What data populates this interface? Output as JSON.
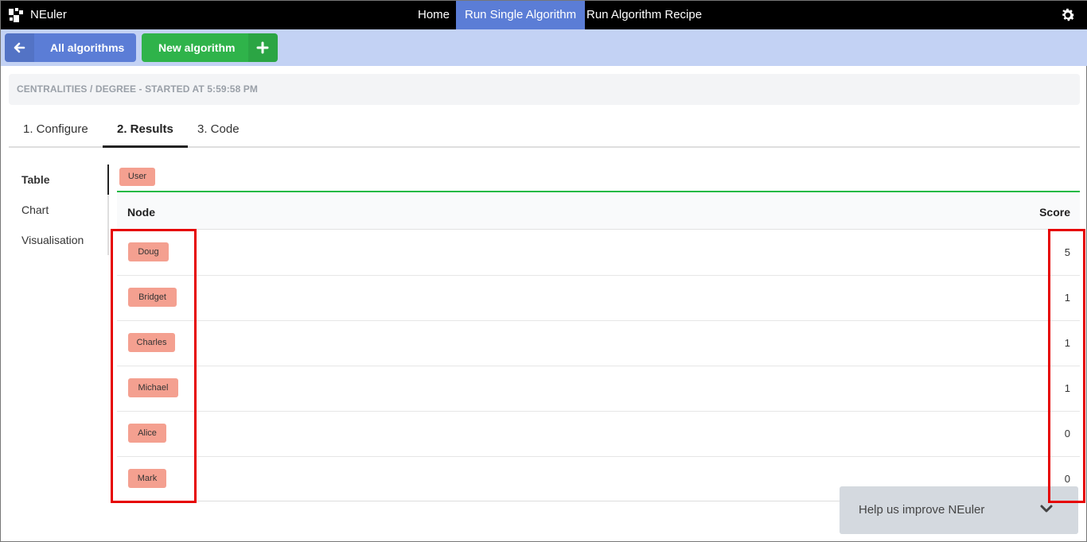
{
  "app": {
    "name": "NEuler"
  },
  "nav": {
    "items": [
      {
        "label": "Home",
        "active": false
      },
      {
        "label": "Run Single Algorithm",
        "active": true
      },
      {
        "label": "Run Algorithm Recipe",
        "active": false
      }
    ]
  },
  "toolbar": {
    "all_algorithms_label": "All algorithms",
    "new_algorithm_label": "New algorithm"
  },
  "breadcrumb": {
    "text": "CENTRALITIES / DEGREE - STARTED AT 5:59:58 PM"
  },
  "tabs": [
    {
      "label": "1. Configure",
      "active": false
    },
    {
      "label": "2. Results",
      "active": true
    },
    {
      "label": "3. Code",
      "active": false
    }
  ],
  "side_menu": [
    {
      "label": "Table",
      "active": true
    },
    {
      "label": "Chart",
      "active": false
    },
    {
      "label": "Visualisation",
      "active": false
    }
  ],
  "label_filter": "User",
  "table": {
    "headers": {
      "node": "Node",
      "score": "Score"
    },
    "rows": [
      {
        "node": "Doug",
        "score": "5"
      },
      {
        "node": "Bridget",
        "score": "1"
      },
      {
        "node": "Charles",
        "score": "1"
      },
      {
        "node": "Michael",
        "score": "1"
      },
      {
        "node": "Alice",
        "score": "0"
      },
      {
        "node": "Mark",
        "score": "0"
      }
    ]
  },
  "feedback": {
    "text": "Help us improve NEuler"
  },
  "colors": {
    "topbar": "#000000",
    "nav_active": "#5b7dd6",
    "toolbar": "#c3d2f4",
    "btn_blue": "#5b7dd6",
    "btn_green": "#2fb34a",
    "chip": "#f4a090",
    "table_accent": "#21ba45",
    "highlight": "#e60000"
  }
}
